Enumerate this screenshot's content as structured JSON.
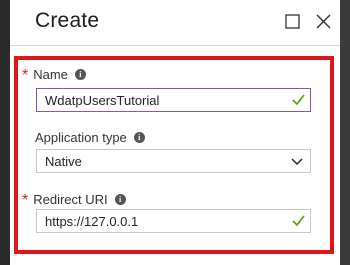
{
  "blade": {
    "title": "Create",
    "maximize_icon": "maximize-icon",
    "close_icon": "close-icon"
  },
  "form": {
    "name": {
      "label": "Name",
      "required": true,
      "value": "WdatpUsersTutorial",
      "valid": true
    },
    "application_type": {
      "label": "Application type",
      "required": false,
      "selected": "Native"
    },
    "redirect_uri": {
      "label": "Redirect URI",
      "required": true,
      "value": "https://127.0.0.1",
      "valid": true
    },
    "required_marker": "*",
    "info_glyph": "i"
  },
  "colors": {
    "highlight_border": "#e0161c",
    "focus_border": "#8a56a8",
    "valid_check": "#57a300",
    "required_asterisk": "#d81b1b"
  }
}
